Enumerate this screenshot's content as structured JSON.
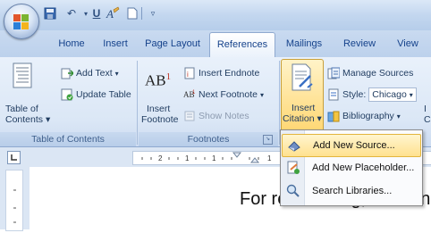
{
  "tabs": [
    {
      "label": "Home"
    },
    {
      "label": "Insert"
    },
    {
      "label": "Page Layout"
    },
    {
      "label": "References",
      "active": true
    },
    {
      "label": "Mailings"
    },
    {
      "label": "Review"
    },
    {
      "label": "View"
    }
  ],
  "ribbon": {
    "toc": {
      "big_line1": "Table of",
      "big_line2": "Contents",
      "add_text": "Add Text",
      "update_table": "Update Table",
      "group_label": "Table of Contents"
    },
    "footnotes": {
      "big_line1": "Insert",
      "big_line2": "Footnote",
      "insert_endnote": "Insert Endnote",
      "next_footnote": "Next Footnote",
      "show_notes": "Show Notes",
      "group_label": "Footnotes",
      "ab_glyph": "AB",
      "ab_super": "1"
    },
    "citations": {
      "big_line1": "Insert",
      "big_line2": "Citation",
      "manage_sources": "Manage Sources",
      "style_label": "Style:",
      "style_value": "Chicago",
      "bibliography": "Bibliography",
      "next_big": "I",
      "next_big2": "C"
    }
  },
  "dropdown": {
    "items": [
      {
        "label": "Add New Source...",
        "highlighted": true
      },
      {
        "label": "Add New Placeholder..."
      },
      {
        "label": "Search Libraries..."
      }
    ]
  },
  "document": {
    "visible_text": "For referencing, click on"
  },
  "colors": {
    "ribbon_text": "#1f3b5f",
    "tab_text": "#15428b",
    "highlight": "#ffe18f"
  }
}
